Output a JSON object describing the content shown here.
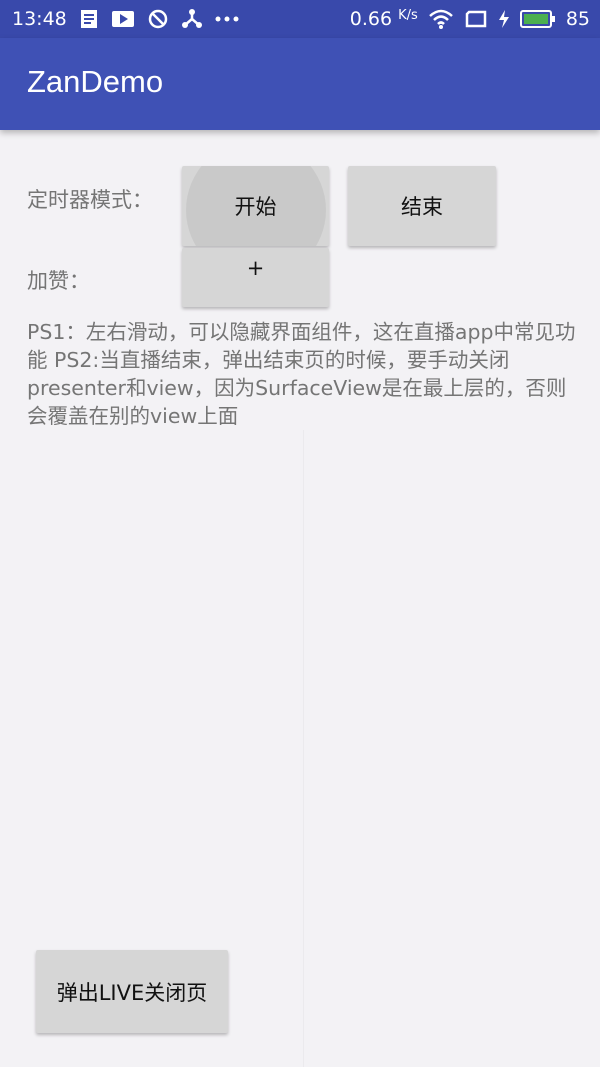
{
  "status_bar": {
    "time": "13:48",
    "speed": "0.66",
    "speed_unit": "K/s",
    "battery": "85"
  },
  "app_bar": {
    "title": "ZanDemo"
  },
  "timer_mode": {
    "label": "定时器模式：",
    "start_label": "开始",
    "end_label": "结束"
  },
  "like": {
    "label": "加赞：",
    "plus_label": "+"
  },
  "description": "PS1：左右滑动，可以隐藏界面组件，这在直播app中常见功能 PS2:当直播结束，弹出结束页的时候，要手动关闭presenter和view，因为SurfaceView是在最上层的，否则会覆盖在别的view上面",
  "popup_button": {
    "label": "弹出LIVE关闭页"
  }
}
